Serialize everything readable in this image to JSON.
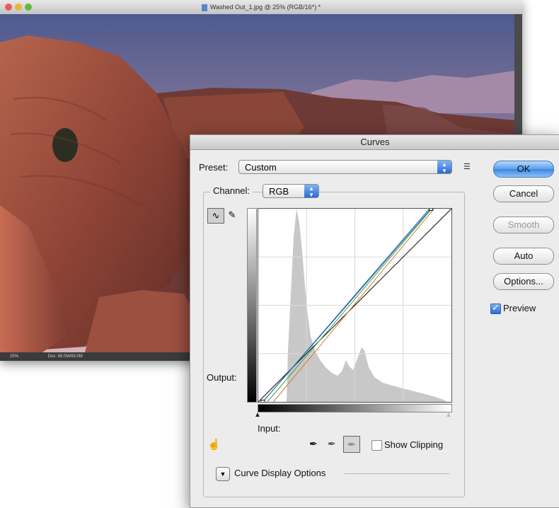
{
  "photo_window": {
    "title": "Washed Out_1.jpg @ 25% (RGB/16*) *",
    "status_zoom": "25%",
    "status_doc": "Doc: 69.0M/69.0M"
  },
  "dialog": {
    "title": "Curves",
    "preset_label": "Preset:",
    "preset_value": "Custom",
    "channel_label": "Channel:",
    "channel_value": "RGB",
    "output_label": "Output:",
    "input_label": "Input:",
    "show_clipping_label": "Show Clipping",
    "show_clipping_checked": false,
    "curve_display_options_label": "Curve Display Options",
    "preview_label": "Preview",
    "preview_checked": true,
    "buttons": {
      "ok": "OK",
      "cancel": "Cancel",
      "smooth": "Smooth",
      "auto": "Auto",
      "options": "Options..."
    }
  },
  "curves": {
    "rgb": [
      [
        0,
        0
      ],
      [
        255,
        255
      ]
    ],
    "red": [
      [
        20,
        0
      ],
      [
        232,
        255
      ]
    ],
    "green": [
      [
        12,
        0
      ],
      [
        229,
        255
      ]
    ],
    "blue": [
      [
        6,
        0
      ],
      [
        226,
        255
      ]
    ],
    "composite": [
      [
        6,
        0
      ],
      [
        228,
        255
      ]
    ],
    "colors": {
      "red": "#d87a30",
      "green": "#3aa55a",
      "blue": "#2f62c9",
      "black": "#111111"
    }
  },
  "colors": {
    "accent": "#3d86e0"
  }
}
